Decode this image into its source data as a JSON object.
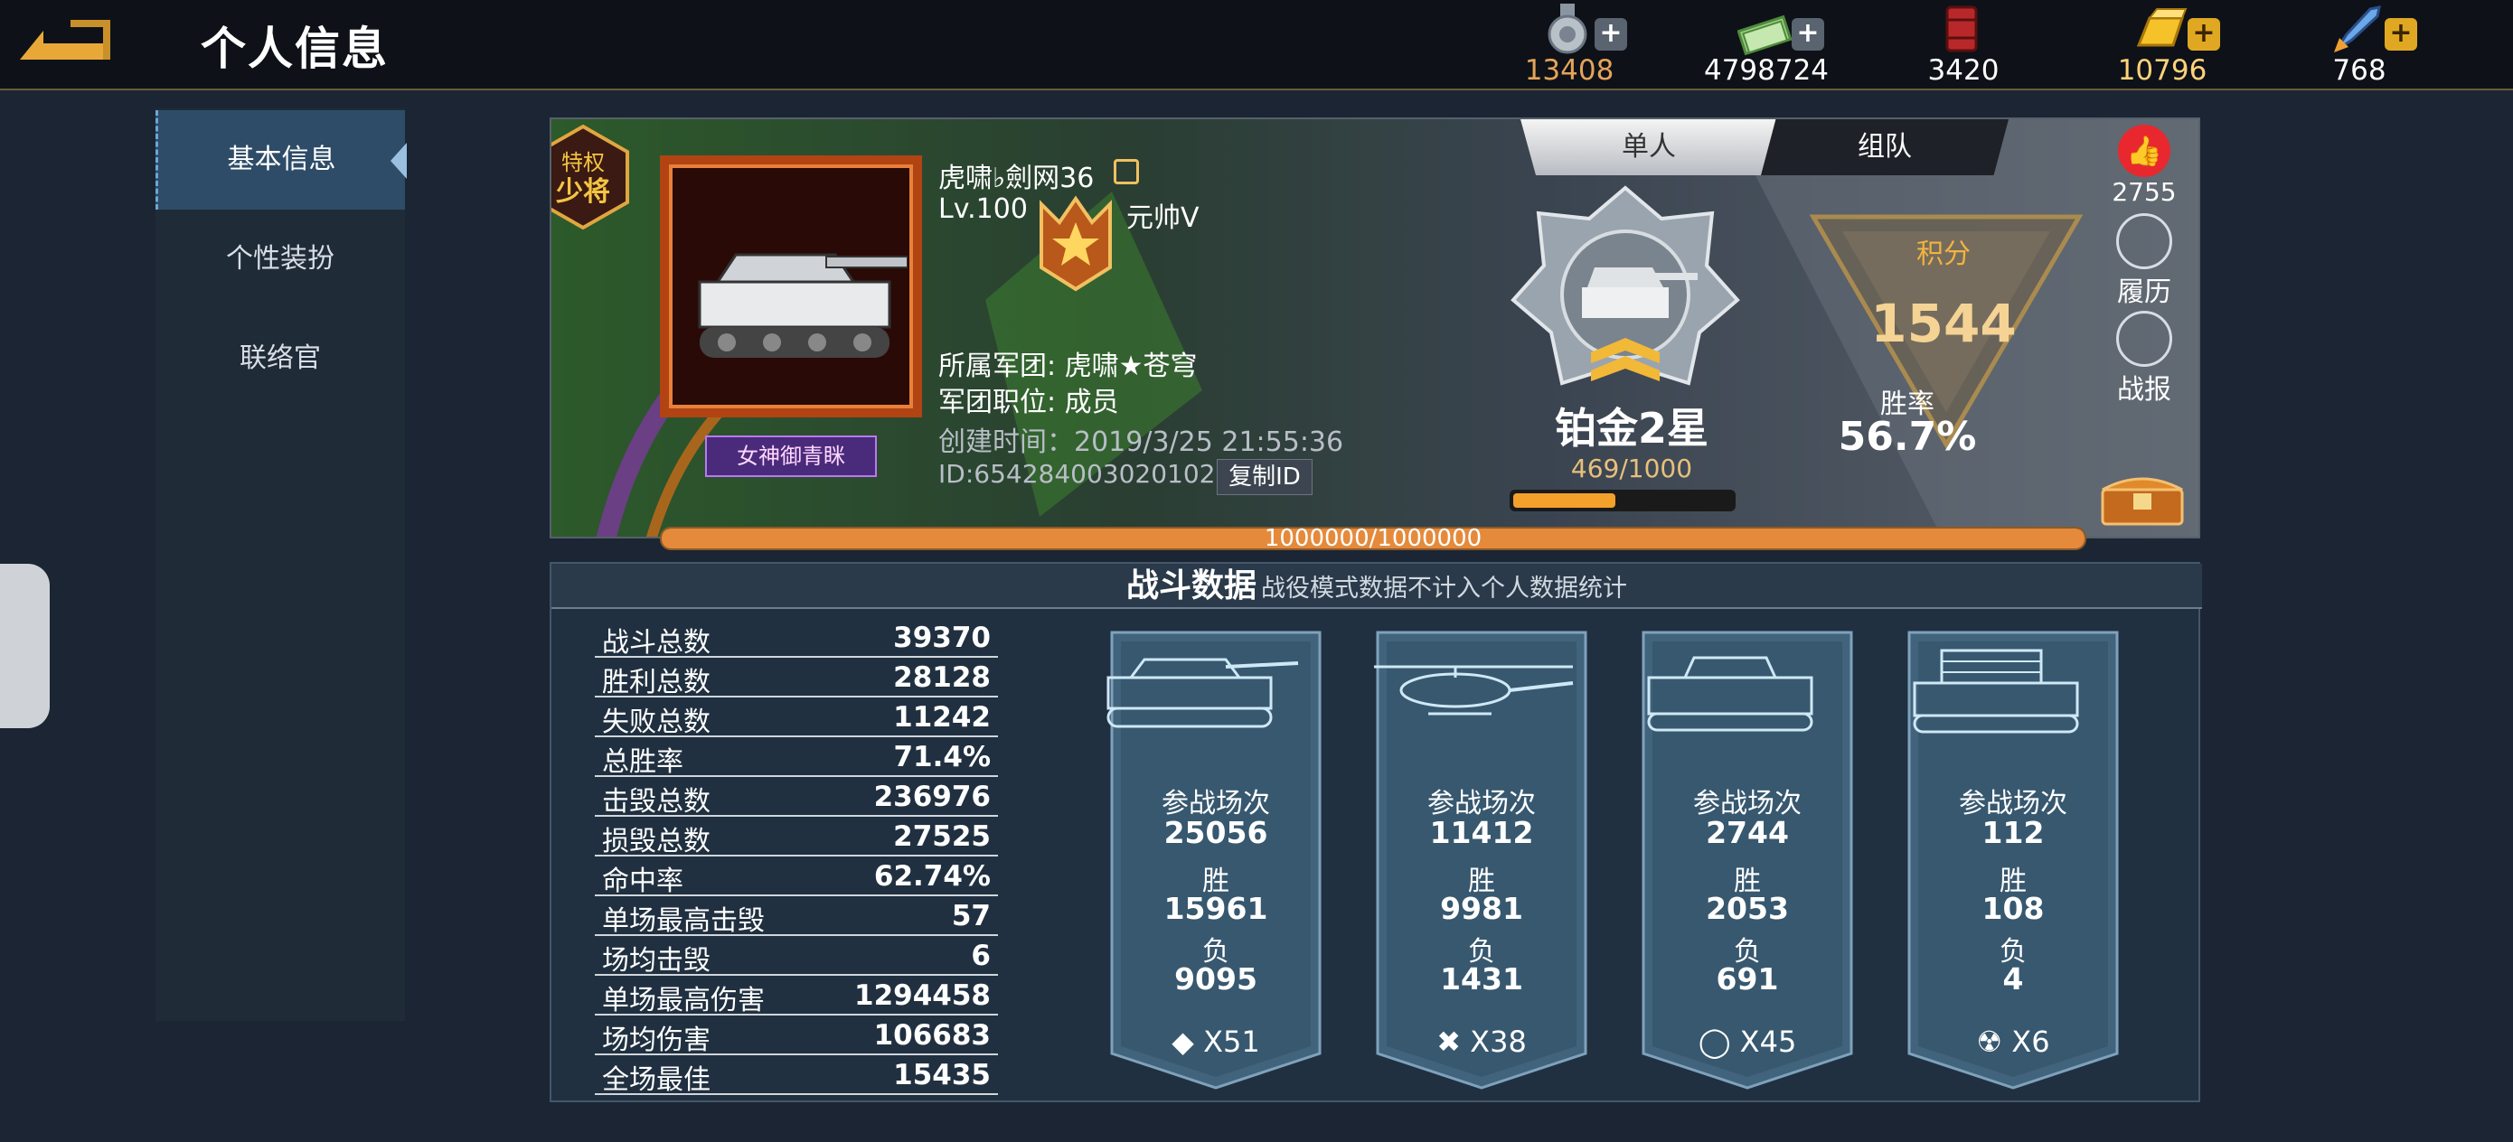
{
  "header": {
    "title": "个人信息",
    "resources": [
      {
        "icon": "medal-coin-icon",
        "value": "13408",
        "color": "#e6a35a",
        "has_add": true
      },
      {
        "icon": "cash-stack-icon",
        "value": "4798724",
        "color": "#ffffff",
        "has_add": true
      },
      {
        "icon": "fuel-barrel-icon",
        "value": "3420",
        "color": "#ffffff",
        "has_add": false
      },
      {
        "icon": "gold-bar-icon",
        "value": "10796",
        "color": "#ffd27a",
        "has_add": true
      },
      {
        "icon": "rocket-icon",
        "value": "768",
        "color": "#ffffff",
        "has_add": true
      }
    ]
  },
  "sidebar": {
    "items": [
      {
        "label": "基本信息",
        "active": true
      },
      {
        "label": "个性装扮",
        "active": false
      },
      {
        "label": "联络官",
        "active": false
      }
    ]
  },
  "profile": {
    "privilege_badge": "特权少将",
    "username": "虎啸♭劍网36",
    "level": "Lv.100",
    "rank_name": "元帅Ⅴ",
    "legion": "所属军团: 虎啸★苍穹",
    "legion_role": "军团职位: 成员",
    "created": "创建时间：2019/3/25 21:55:36",
    "id": "ID:654284003020102",
    "copy_label": "复制ID",
    "nameplate": "女神御青眯",
    "exp_text": "1000000/1000000",
    "exp_fraction": 1.0
  },
  "mode_tabs": {
    "solo": "单人",
    "team": "组队"
  },
  "ranking": {
    "tier": "铂金2星",
    "tier_progress": "469/1000",
    "tier_fraction": 0.469,
    "score_label": "积分",
    "score": "1544",
    "winrate_label": "胜率",
    "winrate": "56.7%"
  },
  "side_actions": {
    "likes": "2755",
    "history": "履历",
    "report": "战报"
  },
  "battle": {
    "title": "战斗数据",
    "note": "战役模式数据不计入个人数据统计",
    "stats": [
      {
        "label": "战斗总数",
        "value": "39370"
      },
      {
        "label": "胜利总数",
        "value": "28128"
      },
      {
        "label": "失败总数",
        "value": "11242"
      },
      {
        "label": "总胜率",
        "value": "71.4%"
      },
      {
        "label": "击毁总数",
        "value": "236976"
      },
      {
        "label": "损毁总数",
        "value": "27525"
      },
      {
        "label": "命中率",
        "value": "62.74%"
      },
      {
        "label": "单场最高击毁",
        "value": "57"
      },
      {
        "label": "场均击毁",
        "value": "6"
      },
      {
        "label": "单场最高伤害",
        "value": "1294458"
      },
      {
        "label": "场均伤害",
        "value": "106683"
      },
      {
        "label": "全场最佳",
        "value": "15435"
      }
    ],
    "vehicle_cards": [
      {
        "vehicle": "main-battle-tank-icon",
        "battles_label": "参战场次",
        "battles": "25056",
        "win_label": "胜",
        "wins": "15961",
        "loss_label": "负",
        "losses": "9095",
        "mark": "◆",
        "count": "X51"
      },
      {
        "vehicle": "attack-helicopter-icon",
        "battles_label": "参战场次",
        "battles": "11412",
        "win_label": "胜",
        "wins": "9981",
        "loss_label": "负",
        "losses": "1431",
        "mark": "✖",
        "count": "X38"
      },
      {
        "vehicle": "infantry-fighting-vehicle-icon",
        "battles_label": "参战场次",
        "battles": "2744",
        "win_label": "胜",
        "wins": "2053",
        "loss_label": "负",
        "losses": "691",
        "mark": "◯",
        "count": "X45"
      },
      {
        "vehicle": "rocket-launcher-vehicle-icon",
        "battles_label": "参战场次",
        "battles": "112",
        "win_label": "胜",
        "wins": "108",
        "loss_label": "负",
        "losses": "4",
        "mark": "☢",
        "count": "X6"
      }
    ]
  }
}
